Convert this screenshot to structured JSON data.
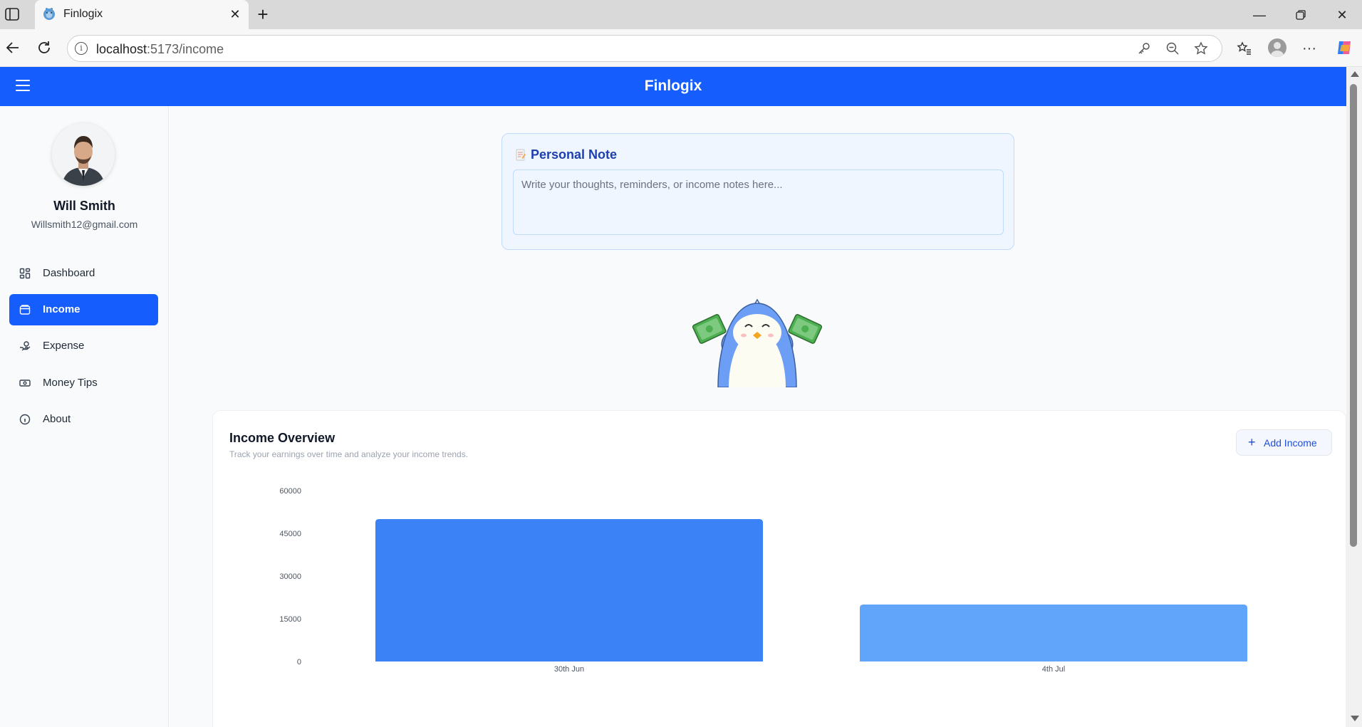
{
  "browser": {
    "tab_title": "Finlogix",
    "url_host": "localhost",
    "url_path": ":5173/income"
  },
  "app": {
    "title": "Finlogix",
    "brand_color": "#155dfc"
  },
  "user": {
    "name": "Will Smith",
    "email": "Willsmith12@gmail.com"
  },
  "sidebar": {
    "items": [
      {
        "label": "Dashboard",
        "icon": "dashboard-grid-icon",
        "active": false
      },
      {
        "label": "Income",
        "icon": "wallet-icon",
        "active": true
      },
      {
        "label": "Expense",
        "icon": "hand-coins-icon",
        "active": false
      },
      {
        "label": "Money Tips",
        "icon": "banknote-icon",
        "active": false
      },
      {
        "label": "About",
        "icon": "info-icon",
        "active": false
      }
    ]
  },
  "note": {
    "title": "Personal Note",
    "placeholder": "Write your thoughts, reminders, or income notes here...",
    "value": ""
  },
  "overview": {
    "title": "Income Overview",
    "subtitle": "Track your earnings over time and analyze your income trends.",
    "add_button_label": "Add Income"
  },
  "chart_data": {
    "type": "bar",
    "categories": [
      "30th Jun",
      "4th Jul"
    ],
    "values": [
      50000,
      20000
    ],
    "bar_colors": [
      "#3b82f6",
      "#60a5fa"
    ],
    "yticks": [
      0,
      15000,
      30000,
      45000,
      60000
    ],
    "ylim": [
      0,
      60000
    ],
    "grid": false,
    "legend": "none"
  }
}
